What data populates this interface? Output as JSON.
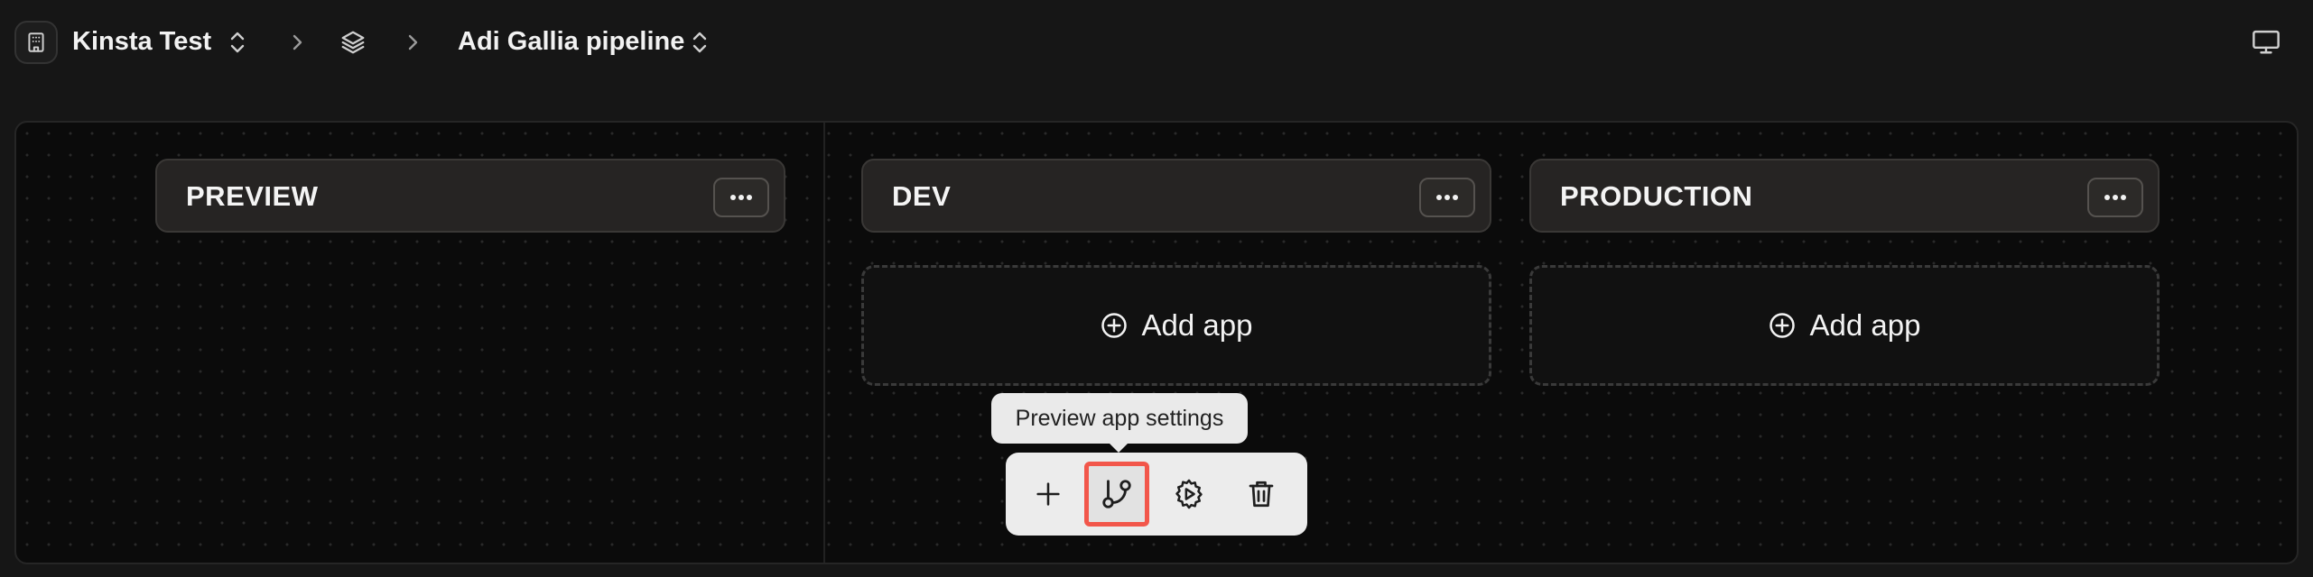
{
  "breadcrumb": {
    "organization": "Kinsta Test",
    "pipeline": "Adi Gallia pipeline"
  },
  "stages": [
    {
      "title": "PREVIEW",
      "more_label": "more options"
    },
    {
      "title": "DEV",
      "add_app_label": "Add app"
    },
    {
      "title": "PRODUCTION",
      "add_app_label": "Add app"
    }
  ],
  "tooltip": {
    "text": "Preview app settings"
  },
  "toolbar": {
    "buttons": [
      {
        "icon": "plus-icon"
      },
      {
        "icon": "git-branch-icon",
        "highlighted": true
      },
      {
        "icon": "settings-play-icon"
      },
      {
        "icon": "trash-icon"
      }
    ]
  },
  "colors": {
    "background": "#161616",
    "board": "#0b0b0b",
    "stage_header": "#262423",
    "toolbar": "#ececec",
    "highlight": "#f2564a"
  }
}
